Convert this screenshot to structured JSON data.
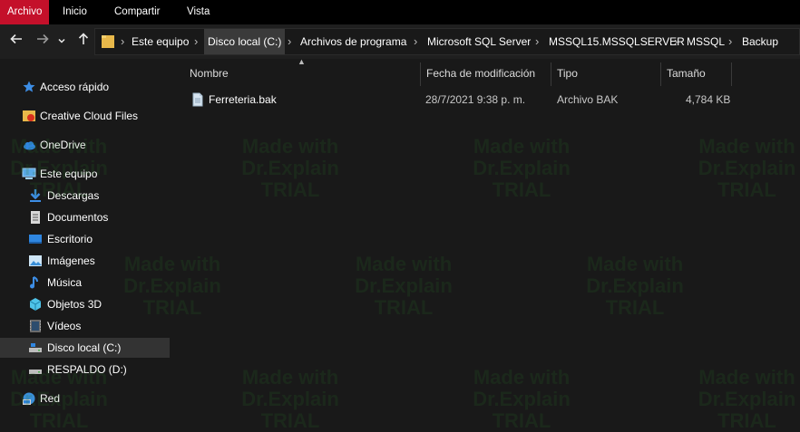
{
  "ribbon": {
    "tabs": [
      {
        "label": "Archivo",
        "active": true
      },
      {
        "label": "Inicio",
        "active": false
      },
      {
        "label": "Compartir",
        "active": false
      },
      {
        "label": "Vista",
        "active": false
      }
    ],
    "accent_color": "#c4102a"
  },
  "nav": {
    "back_icon": "arrow-left-icon",
    "forward_icon": "arrow-right-icon",
    "recent_icon": "chevron-down-icon",
    "up_icon": "arrow-up-icon"
  },
  "breadcrumb": [
    "Este equipo",
    "Disco local (C:)",
    "Archivos de programa",
    "Microsoft SQL Server",
    "MSSQL15.MSSQLSERVER",
    "MSSQL",
    "Backup"
  ],
  "sidebar": {
    "items": [
      {
        "label": "Acceso rápido",
        "icon": "star-icon"
      },
      {
        "label": "Creative Cloud Files",
        "icon": "creative-cloud-icon"
      },
      {
        "label": "OneDrive",
        "icon": "cloud-icon"
      },
      {
        "label": "Este equipo",
        "icon": "computer-icon"
      },
      {
        "label": "Descargas",
        "icon": "download-icon"
      },
      {
        "label": "Documentos",
        "icon": "document-icon"
      },
      {
        "label": "Escritorio",
        "icon": "desktop-icon"
      },
      {
        "label": "Imágenes",
        "icon": "image-icon"
      },
      {
        "label": "Música",
        "icon": "music-icon"
      },
      {
        "label": "Objetos 3D",
        "icon": "cube-icon"
      },
      {
        "label": "Vídeos",
        "icon": "video-icon"
      },
      {
        "label": "Disco local (C:)",
        "icon": "drive-icon",
        "selected": true
      },
      {
        "label": "RESPALDO (D:)",
        "icon": "drive-icon"
      },
      {
        "label": "Red",
        "icon": "network-icon"
      }
    ]
  },
  "columns": {
    "name": "Nombre",
    "date": "Fecha de modificación",
    "type": "Tipo",
    "size": "Tamaño"
  },
  "files": [
    {
      "name": "Ferreteria.bak",
      "date": "28/7/2021 9:38 p. m.",
      "type": "Archivo BAK",
      "size": "4,784 KB",
      "icon": "file-icon"
    }
  ],
  "watermark": [
    "Made with",
    "Dr.Explain",
    "TRIAL"
  ]
}
